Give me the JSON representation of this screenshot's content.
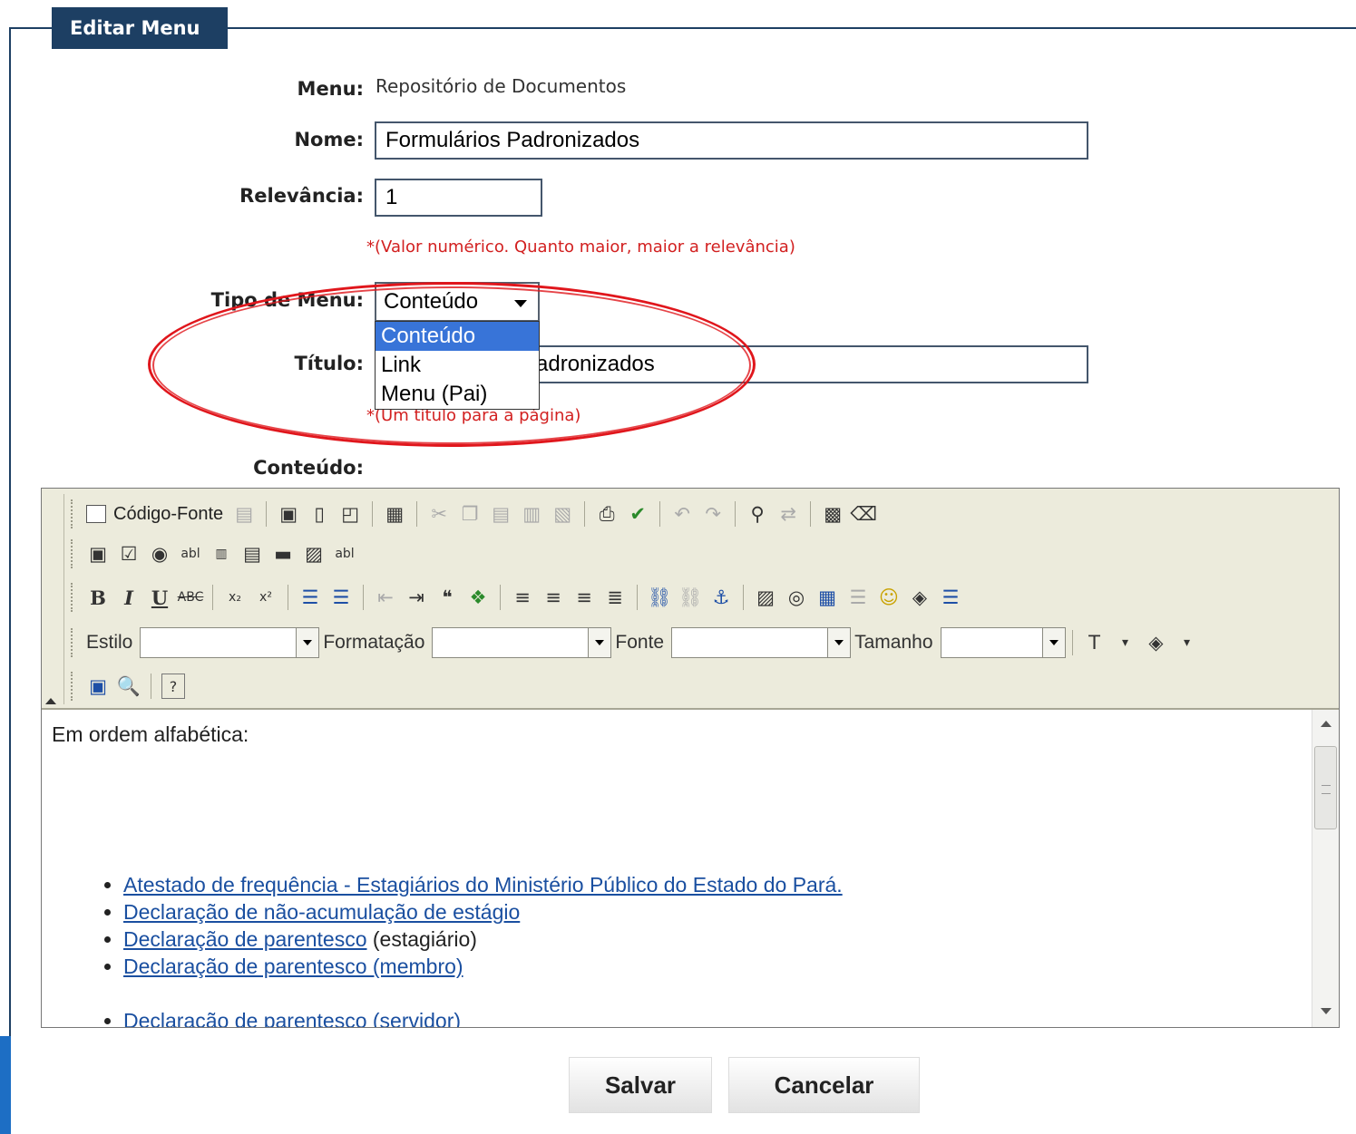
{
  "fieldset": {
    "legend": "Editar Menu"
  },
  "form": {
    "menu_label": "Menu:",
    "menu_value": "Repositório de Documentos",
    "nome_label": "Nome:",
    "nome_value": "Formulários Padronizados",
    "relevancia_label": "Relevância:",
    "relevancia_value": "1",
    "relevancia_note": "*(Valor numérico. Quanto maior, maior a relevância)",
    "tipo_label": "Tipo de Menu:",
    "tipo_value": "Conteúdo",
    "tipo_options": [
      "Conteúdo",
      "Link",
      "Menu (Pai)"
    ],
    "titulo_label": "Título:",
    "titulo_value": "Formulários Padronizados",
    "titulo_visible": "adronizados",
    "titulo_note": "*(Um título para a página)",
    "conteudo_label": "Conteúdo:"
  },
  "toolbar": {
    "source_button": "Código-Fonte",
    "estilo_label": "Estilo",
    "formatacao_label": "Formatação",
    "fonte_label": "Fonte",
    "tamanho_label": "Tamanho",
    "icons": {
      "row1": [
        "source-icon",
        "templates-icon",
        "save-icon",
        "new-page-icon",
        "preview-icon",
        "template-icon",
        "cut-icon",
        "copy-icon",
        "paste-icon",
        "paste-text-icon",
        "paste-word-icon",
        "print-icon",
        "spellcheck-icon",
        "undo-icon",
        "redo-icon",
        "find-icon",
        "replace-icon",
        "select-all-icon",
        "remove-format-icon"
      ],
      "row2": [
        "form-icon",
        "checkbox-icon",
        "radio-icon",
        "textfield-icon",
        "textarea-icon",
        "select-icon",
        "button-icon",
        "image-button-icon",
        "hidden-field-icon"
      ],
      "row3": [
        "bold-icon",
        "italic-icon",
        "underline-icon",
        "strike-icon",
        "subscript-icon",
        "superscript-icon",
        "ordered-list-icon",
        "unordered-list-icon",
        "outdent-icon",
        "indent-icon",
        "blockquote-icon",
        "div-icon",
        "align-left-icon",
        "align-center-icon",
        "align-right-icon",
        "justify-icon",
        "link-icon",
        "unlink-icon",
        "anchor-icon",
        "image-icon",
        "flash-icon",
        "table-icon",
        "horizontal-rule-icon",
        "smiley-icon",
        "special-char-icon",
        "page-break-icon"
      ],
      "row5": [
        "maximize-icon",
        "show-blocks-icon",
        "about-icon"
      ]
    },
    "glyphs": {
      "bold": "B",
      "italic": "I",
      "underline": "U",
      "strike": "ABC",
      "subscript": "x₂",
      "superscript": "x²",
      "blockquote": "❝",
      "anchor": "⚓",
      "smiley": "☺",
      "help": "?",
      "text_color": "T",
      "bg_color": "◈",
      "find": "🔍"
    }
  },
  "editor_content": {
    "intro": "Em ordem alfabética:",
    "items": [
      {
        "link": "Atestado de frequência - Estagiários do Ministério Público do Estado do Pará.",
        "suffix": ""
      },
      {
        "link": "Declaração de não-acumulação de estágio",
        "suffix": ""
      },
      {
        "link": "Declaração de parentesco",
        "suffix": " (estagiário)"
      },
      {
        "link": "Declaração de parentesco (membro)",
        "suffix": ""
      },
      {
        "link": "Declaração de parentesco (servidor)",
        "suffix": ""
      }
    ]
  },
  "actions": {
    "save": "Salvar",
    "cancel": "Cancelar"
  },
  "colors": {
    "legend_bg": "#1d3f63",
    "note": "#d22020",
    "highlight_oval": "#e0161c",
    "selected_option": "#3874d8",
    "link": "#1a4fa0"
  }
}
